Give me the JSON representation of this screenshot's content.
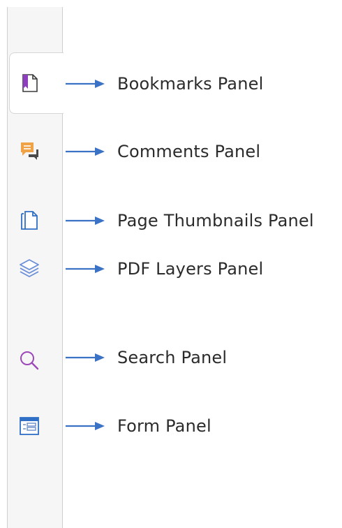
{
  "sidebar": {
    "tabs": [
      {
        "icon": "bookmark-icon",
        "label": "Bookmarks Panel",
        "active": true
      },
      {
        "icon": "comments-icon",
        "label": "Comments Panel",
        "active": false
      },
      {
        "icon": "page-thumbnails-icon",
        "label": "Page Thumbnails Panel",
        "active": false
      },
      {
        "icon": "layers-icon",
        "label": "PDF Layers Panel",
        "active": false
      },
      {
        "icon": "search-icon",
        "label": "Search Panel",
        "active": false
      },
      {
        "icon": "form-icon",
        "label": "Form Panel",
        "active": false
      }
    ]
  },
  "colors": {
    "arrow": "#3a72c6",
    "bookmark": "#8e3fbf",
    "comments": "#f0a247",
    "thumbnails": "#2f6fc5",
    "layers": "#6a8fd9",
    "search": "#9c48b8",
    "form": "#2f6fc5",
    "sidebar_bg": "#f6f6f6"
  }
}
